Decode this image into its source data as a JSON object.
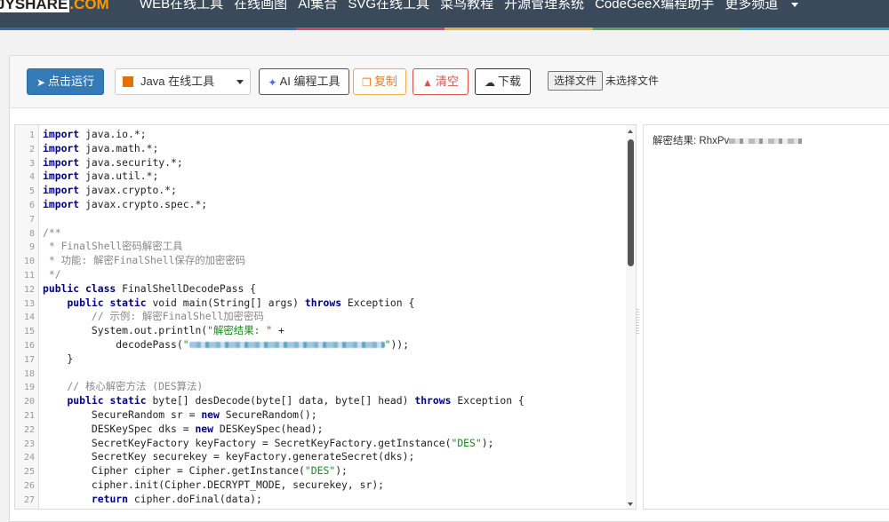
{
  "nav": {
    "logo_part1": "JYSHARE",
    "logo_part2": ".COM",
    "links": [
      "WEB在线工具",
      "在线画图",
      "AI集合",
      "SVG在线工具",
      "菜鸟教程",
      "开源管理系统",
      "CodeGeeX编程助手"
    ],
    "more": "更多频道",
    "rainbow_colors": [
      "#2f6fb0",
      "#2f6fb0",
      "#c94b6d",
      "#e3b04b",
      "#56a86b",
      "#3da0c9"
    ]
  },
  "toolbar": {
    "run_label": "点击运行",
    "language_selected": "Java 在线工具",
    "ai_label": "AI 编程工具",
    "copy_label": "复制",
    "clear_label": "清空",
    "download_label": "下载",
    "choose_file_label": "选择文件",
    "no_file_label": "未选择文件"
  },
  "editor": {
    "lines": [
      {
        "n": "1",
        "parts": [
          [
            "kw",
            "import"
          ],
          [
            "",
            "java.io.*;"
          ]
        ]
      },
      {
        "n": "2",
        "parts": [
          [
            "kw",
            "import"
          ],
          [
            "",
            "java.math.*;"
          ]
        ]
      },
      {
        "n": "3",
        "parts": [
          [
            "kw",
            "import"
          ],
          [
            "",
            "java.security.*;"
          ]
        ]
      },
      {
        "n": "4",
        "parts": [
          [
            "kw",
            "import"
          ],
          [
            "",
            "java.util.*;"
          ]
        ]
      },
      {
        "n": "5",
        "parts": [
          [
            "kw",
            "import"
          ],
          [
            "",
            "javax.crypto.*;"
          ]
        ]
      },
      {
        "n": "6",
        "parts": [
          [
            "kw",
            "import"
          ],
          [
            "",
            "javax.crypto.spec.*;"
          ]
        ]
      },
      {
        "n": "7",
        "parts": []
      },
      {
        "n": "8",
        "parts": [
          [
            "cm",
            "/**"
          ]
        ]
      },
      {
        "n": "9",
        "parts": [
          [
            "cm",
            " * FinalShell密码解密工具"
          ]
        ]
      },
      {
        "n": "10",
        "parts": [
          [
            "cm",
            " * 功能: 解密FinalShell保存的加密密码"
          ]
        ]
      },
      {
        "n": "11",
        "parts": [
          [
            "cm",
            " */"
          ]
        ]
      },
      {
        "n": "12",
        "parts": [
          [
            "kw",
            "public class"
          ],
          [
            "",
            "FinalShellDecodePass {"
          ]
        ]
      },
      {
        "n": "13",
        "parts": [
          [
            "",
            "    "
          ],
          [
            "kw",
            "public static"
          ],
          [
            "",
            " void main(String[] args) "
          ],
          [
            "kw",
            "throws"
          ],
          [
            "",
            " Exception {"
          ]
        ]
      },
      {
        "n": "14",
        "parts": [
          [
            "cm",
            "        // 示例: 解密FinalShell加密密码"
          ]
        ]
      },
      {
        "n": "15",
        "parts": [
          [
            "",
            "        System.out.println("
          ],
          [
            "str",
            "\"解密结果: \""
          ],
          [
            "",
            " +"
          ]
        ]
      },
      {
        "n": "16",
        "parts": [
          [
            "",
            "            decodePass("
          ],
          [
            "str",
            "\""
          ],
          [
            "blur",
            ""
          ],
          [
            "str",
            "\""
          ],
          [
            "",
            "));"
          ]
        ]
      },
      {
        "n": "17",
        "parts": [
          [
            "",
            "    }"
          ]
        ]
      },
      {
        "n": "18",
        "parts": []
      },
      {
        "n": "19",
        "parts": [
          [
            "cm",
            "    // 核心解密方法 (DES算法)"
          ]
        ]
      },
      {
        "n": "20",
        "parts": [
          [
            "",
            "    "
          ],
          [
            "kw",
            "public static"
          ],
          [
            "",
            " byte[] desDecode(byte[] data, byte[] head) "
          ],
          [
            "kw",
            "throws"
          ],
          [
            "",
            " Exception {"
          ]
        ]
      },
      {
        "n": "21",
        "parts": [
          [
            "",
            "        SecureRandom sr = "
          ],
          [
            "kw",
            "new"
          ],
          [
            "",
            " SecureRandom();"
          ]
        ]
      },
      {
        "n": "22",
        "parts": [
          [
            "",
            "        DESKeySpec dks = "
          ],
          [
            "kw",
            "new"
          ],
          [
            "",
            " DESKeySpec(head);"
          ]
        ]
      },
      {
        "n": "23",
        "parts": [
          [
            "",
            "        SecretKeyFactory keyFactory = SecretKeyFactory.getInstance("
          ],
          [
            "str",
            "\"DES\""
          ],
          [
            "",
            ");"
          ]
        ]
      },
      {
        "n": "24",
        "parts": [
          [
            "",
            "        SecretKey securekey = keyFactory.generateSecret(dks);"
          ]
        ]
      },
      {
        "n": "25",
        "parts": [
          [
            "",
            "        Cipher cipher = Cipher.getInstance("
          ],
          [
            "str",
            "\"DES\""
          ],
          [
            "",
            ");"
          ]
        ]
      },
      {
        "n": "26",
        "parts": [
          [
            "",
            "        cipher.init(Cipher.DECRYPT_MODE, securekey, sr);"
          ]
        ]
      },
      {
        "n": "27",
        "parts": [
          [
            "",
            "        "
          ],
          [
            "kw",
            "return"
          ],
          [
            "",
            " cipher.doFinal(data);"
          ]
        ]
      }
    ]
  },
  "output": {
    "result_label": "解密结果: RhxPv"
  }
}
